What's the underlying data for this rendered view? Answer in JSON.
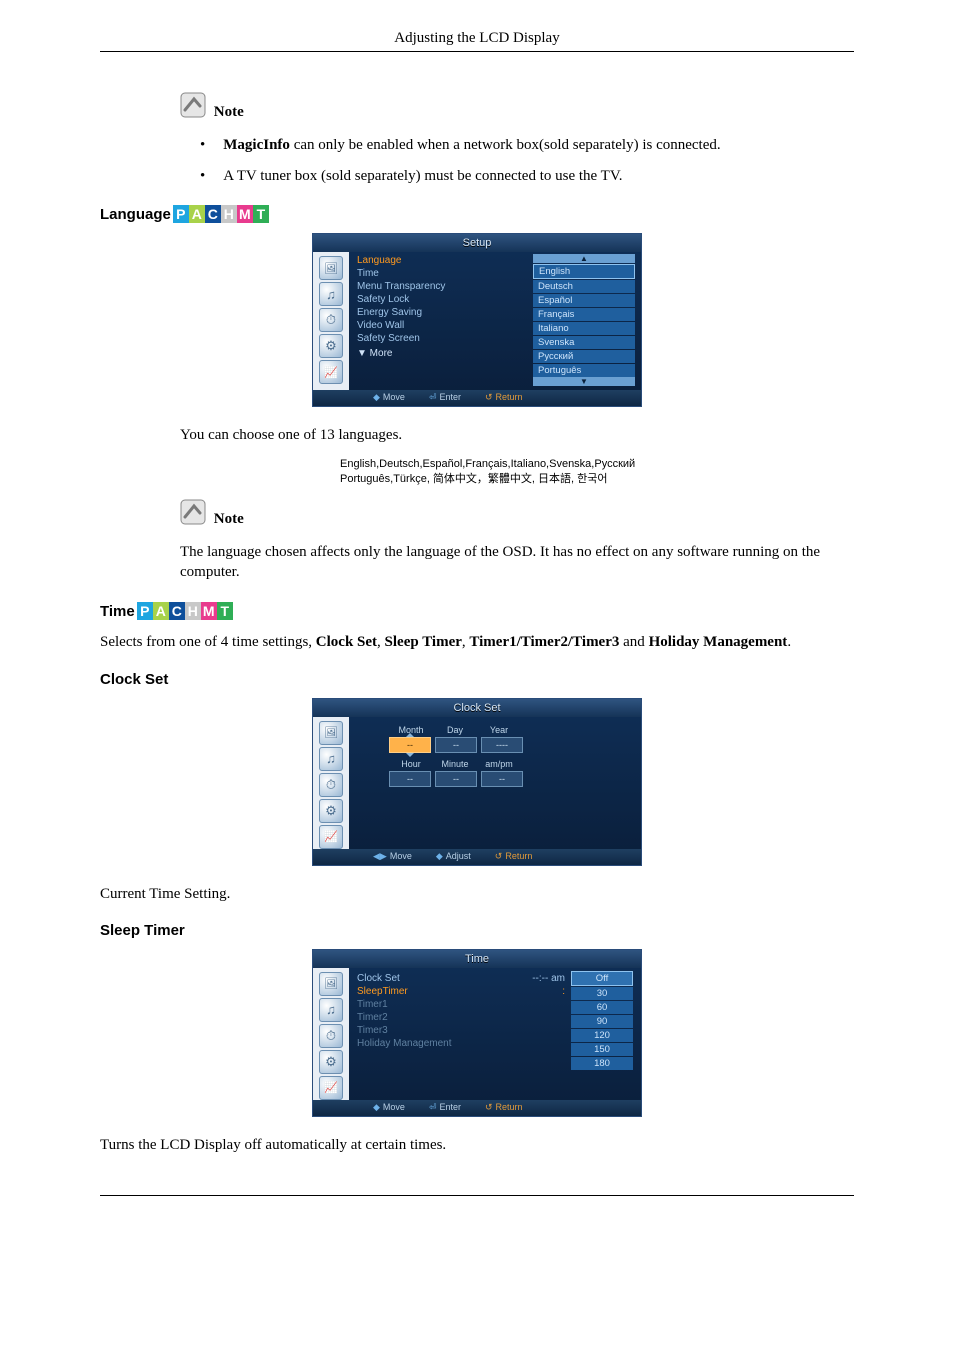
{
  "header": {
    "title": "Adjusting the LCD Display"
  },
  "notes": {
    "label": "Note",
    "top_bullets": [
      {
        "prefix": "MagicInfo",
        "text": " can only be enabled when a network box(sold separately) is connected."
      },
      {
        "prefix": "",
        "text": "A TV tuner box (sold separately) must be connected to use the TV."
      }
    ]
  },
  "sections": {
    "language": {
      "title": "Language",
      "badges": [
        "P",
        "A",
        "C",
        "H",
        "M",
        "T"
      ],
      "osd": {
        "title": "Setup",
        "left_items": [
          {
            "label": "Language",
            "highlight": true
          },
          {
            "label": "Time"
          },
          {
            "label": "Menu Transparency"
          },
          {
            "label": "Safety Lock"
          },
          {
            "label": "Energy Saving"
          },
          {
            "label": "Video Wall"
          },
          {
            "label": "Safety Screen"
          }
        ],
        "more_label": "▼ More",
        "right_items": [
          "English",
          "Deutsch",
          "Español",
          "Français",
          "Italiano",
          "Svenska",
          "Русский",
          "Português"
        ],
        "footer": {
          "move": "Move",
          "enter": "Enter",
          "return": "Return"
        }
      },
      "intro_text": "You can choose one of 13 languages.",
      "lang_line1": "English,Deutsch,Español,Français,Italiano,Svenska,Русский",
      "lang_line2": "Português,Türkçe, 简体中文，繁體中文, 日本語, 한국어",
      "note_text": "The language chosen affects only the language of the OSD. It has no effect on any software running on the computer."
    },
    "time": {
      "title": "Time",
      "badges": [
        "P",
        "A",
        "C",
        "H",
        "M",
        "T"
      ],
      "intro_pre": "Selects from one of 4 time settings, ",
      "b1": "Clock Set",
      "sep1": ", ",
      "b2": "Sleep Timer",
      "sep2": ", ",
      "b3": "Timer1/Timer2/Timer3",
      "sep3": " and ",
      "b4": "Holiday Management",
      "sep4": "."
    },
    "clockset": {
      "title": "Clock Set",
      "osd": {
        "title": "Clock Set",
        "row1_labels": [
          "Month",
          "Day",
          "Year"
        ],
        "row1_values": [
          "--",
          "--",
          "----"
        ],
        "row2_labels": [
          "Hour",
          "Minute",
          "am/pm"
        ],
        "row2_values": [
          "--",
          "--",
          "--"
        ],
        "footer": {
          "move": "Move",
          "adjust": "Adjust",
          "return": "Return"
        }
      },
      "caption": "Current Time Setting."
    },
    "sleeptimer": {
      "title": "Sleep Timer",
      "osd": {
        "title": "Time",
        "left": [
          {
            "label": "Clock Set",
            "value": "--:-- am",
            "cls": ""
          },
          {
            "label": "SleepTimer",
            "value": ":",
            "cls": "hl"
          },
          {
            "label": "Timer1",
            "value": "",
            "cls": "dim"
          },
          {
            "label": "Timer2",
            "value": "",
            "cls": "dim"
          },
          {
            "label": "Timer3",
            "value": "",
            "cls": "dim"
          },
          {
            "label": "Holiday Management",
            "value": "",
            "cls": "dim"
          }
        ],
        "right": [
          "Off",
          "30",
          "60",
          "90",
          "120",
          "150",
          "180"
        ],
        "footer": {
          "move": "Move",
          "enter": "Enter",
          "return": "Return"
        }
      },
      "caption": "Turns the LCD Display off automatically at certain times."
    }
  }
}
